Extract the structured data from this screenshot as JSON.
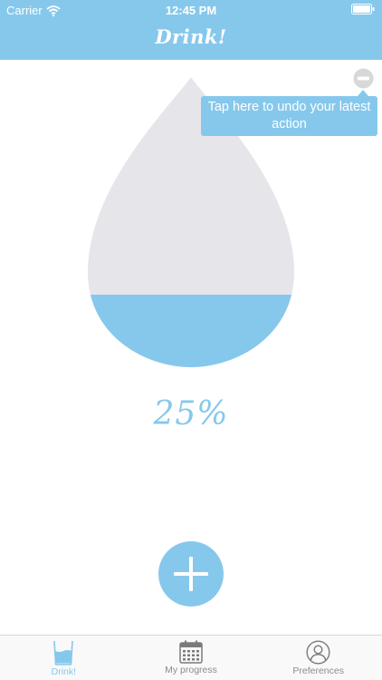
{
  "status_bar": {
    "carrier": "Carrier",
    "time": "12:45 PM"
  },
  "nav": {
    "title": "Drink!"
  },
  "tooltip": {
    "text": "Tap here to undo your latest action"
  },
  "progress": {
    "percent_label": "25%",
    "fill_fraction": 0.25
  },
  "tabs": [
    {
      "label": "Drink!",
      "icon": "glass-icon",
      "active": true
    },
    {
      "label": "My progress",
      "icon": "calendar-icon",
      "active": false
    },
    {
      "label": "Preferences",
      "icon": "person-icon",
      "active": false
    }
  ],
  "colors": {
    "accent": "#86c8ec",
    "drop_empty": "#e6e5ea",
    "tab_inactive": "#8c8c8c",
    "undo_button": "#d8d8d8"
  }
}
